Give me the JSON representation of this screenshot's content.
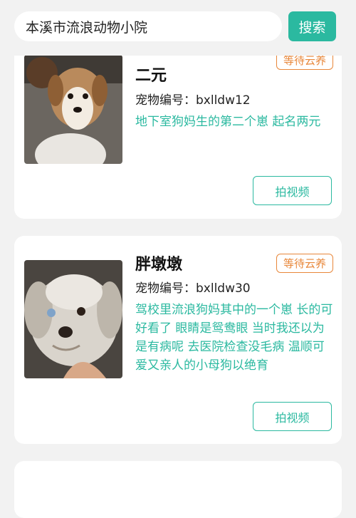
{
  "search": {
    "value": "本溪市流浪动物小院",
    "button_label": "搜索"
  },
  "pets": [
    {
      "name": "二元",
      "status": "等待云养",
      "id_label": "宠物编号",
      "id_value": "bxlldw12",
      "description": "地下室狗妈生的第二个崽 起名两元",
      "video_button": "拍视频",
      "photo_icon": "dog-photo"
    },
    {
      "name": "胖墩墩",
      "status": "等待云养",
      "id_label": "宠物编号",
      "id_value": "bxlldw30",
      "description": "驾校里流浪狗妈其中的一个崽 长的可好看了 眼睛是鸳鸯眼 当时我还以为是有病呢 去医院检查没毛病 温顺可爱又亲人的小母狗以绝育",
      "video_button": "拍视频",
      "photo_icon": "dog-photo"
    }
  ],
  "colors": {
    "accent": "#2bb9a0",
    "badge": "#e8873a",
    "background": "#f2f2f2"
  }
}
